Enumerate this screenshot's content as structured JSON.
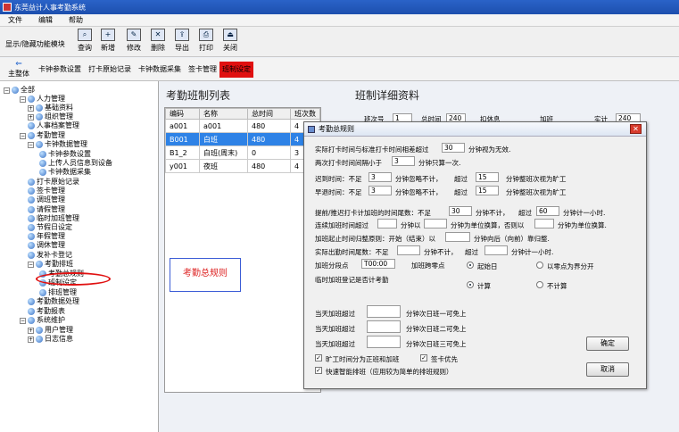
{
  "window": {
    "title": "东莞益计人事考勤系统"
  },
  "menu": [
    "文件",
    "编辑",
    "帮助"
  ],
  "toolbar": {
    "toggle_label": "显示/隐藏功能模块",
    "buttons": [
      {
        "label": "查询",
        "icon": "search-icon"
      },
      {
        "label": "新增",
        "icon": "add-icon"
      },
      {
        "label": "修改",
        "icon": "edit-icon"
      },
      {
        "label": "删除",
        "icon": "delete-icon"
      },
      {
        "label": "导出",
        "icon": "export-icon"
      },
      {
        "label": "打印",
        "icon": "print-icon"
      },
      {
        "label": "关闭",
        "icon": "close-icon"
      }
    ]
  },
  "tabs": {
    "home": "主整体",
    "items": [
      "卡钟参数设置",
      "打卡原始记录",
      "卡钟数据采集",
      "签卡管理",
      "班制设定"
    ]
  },
  "tree": [
    {
      "label": "全部",
      "sign": "⊟"
    },
    {
      "label": "人力管理",
      "sign": "⊟"
    },
    {
      "label": "基础资料",
      "sign": "⊞"
    },
    {
      "label": "组织管理",
      "sign": "⊞"
    },
    {
      "label": "人事档案管理",
      "sign": ""
    },
    {
      "label": "考勤管理",
      "sign": "⊟"
    },
    {
      "label": "卡钟数据管理",
      "sign": "⊟"
    },
    {
      "label": "卡钟参数设置",
      "sign": ""
    },
    {
      "label": "上传人员信息到设备",
      "sign": ""
    },
    {
      "label": "卡钟数据采集",
      "sign": ""
    },
    {
      "label": "打卡原始记录",
      "sign": ""
    },
    {
      "label": "签卡管理",
      "sign": ""
    },
    {
      "label": "调班管理",
      "sign": ""
    },
    {
      "label": "请假管理",
      "sign": ""
    },
    {
      "label": "临时加班管理",
      "sign": ""
    },
    {
      "label": "节假日设定",
      "sign": ""
    },
    {
      "label": "年假管理",
      "sign": ""
    },
    {
      "label": "调休管理",
      "sign": ""
    },
    {
      "label": "发补卡登记",
      "sign": ""
    },
    {
      "label": "考勤排班",
      "sign": "⊟"
    },
    {
      "label": "考勤总规则",
      "sign": ""
    },
    {
      "label": "班制设定",
      "sign": ""
    },
    {
      "label": "排班管理",
      "sign": ""
    },
    {
      "label": "考勤数据处理",
      "sign": ""
    },
    {
      "label": "考勤报表",
      "sign": ""
    },
    {
      "label": "系统维护",
      "sign": "⊟"
    },
    {
      "label": "用户管理",
      "sign": "⊞"
    },
    {
      "label": "日志信息",
      "sign": "⊞"
    }
  ],
  "list": {
    "title": "考勤班制列表",
    "headers": [
      "编码",
      "名称",
      "总时间",
      "班次数"
    ],
    "rows": [
      [
        "a001",
        "a001",
        "480",
        "4"
      ],
      [
        "B001",
        "白班",
        "480",
        "4"
      ],
      [
        "B1_2",
        "白班(周末)",
        "0",
        "3"
      ],
      [
        "y001",
        "夜班",
        "480",
        "4"
      ]
    ],
    "selected_row": 1
  },
  "detail": {
    "title": "班制详细资料",
    "peek": [
      "班次号",
      "1",
      "总时间",
      "240",
      "扣休息",
      "加班",
      "实计",
      "240"
    ]
  },
  "note": "考勤总规则",
  "dialog": {
    "title": "考勤总规则",
    "r1": {
      "pre": "实际打卡时间与标准打卡时间相差超过",
      "val": "30",
      "post": "分钟视为无效."
    },
    "r2": {
      "pre": "两次打卡时间间隔小于",
      "val": "3",
      "post": "分钟只算一次."
    },
    "r3": {
      "pre": "迟到时间：不足",
      "v1": "3",
      "mid": "分钟忽略不计，",
      "mid2": "超过",
      "v2": "15",
      "post": "分钟整班次视为旷工"
    },
    "r4": {
      "pre": "早退时间：不足",
      "v1": "3",
      "mid": "分钟忽略不计，",
      "mid2": "超过",
      "v2": "15",
      "post": "分钟整班次视为旷工"
    },
    "r5": {
      "pre": "提前/推迟打卡计加班的时间尾数：不足",
      "v1": "30",
      "mid": "分钟不计，",
      "mid2": "超过",
      "v2": "60",
      "post": "分钟计一小时."
    },
    "r6": {
      "pre": "连续加班时间超过",
      "mid": "分钟以",
      "post": "分钟为单位换算，否则以",
      "post2": "分钟为单位换算."
    },
    "r7": {
      "pre": "加班起止时间归整原则：开始（结束）以",
      "post": "分钟向后（向前）靠归整."
    },
    "r8": {
      "pre": "实际出勤时间尾数：不足",
      "mid": "分钟不计，",
      "mid2": "超过",
      "post": "分钟计一小时."
    },
    "r9": {
      "pre": "加班分段点",
      "val": "T00:00",
      "mid": "加班跨零点",
      "opt1": "起始日",
      "opt2": "以零点为界分开"
    },
    "r10": {
      "pre": "临时加班登记是否计考勤",
      "opt1": "计算",
      "opt2": "不计算"
    },
    "ot": [
      {
        "pre": "当天加班超过",
        "post": "分钟次日班一可免上"
      },
      {
        "pre": "当天加班超过",
        "post": "分钟次日班二可免上"
      },
      {
        "pre": "当天加班超过",
        "post": "分钟次日班三可免上"
      }
    ],
    "checks": [
      {
        "label": "旷工时间分为正班和加班",
        "checked": true
      },
      {
        "label": "签卡优先",
        "checked": true
      },
      {
        "label": "快速智能排班（应用较为简单的排班规则）",
        "checked": true
      }
    ],
    "ok": "确定",
    "cancel": "取消"
  }
}
